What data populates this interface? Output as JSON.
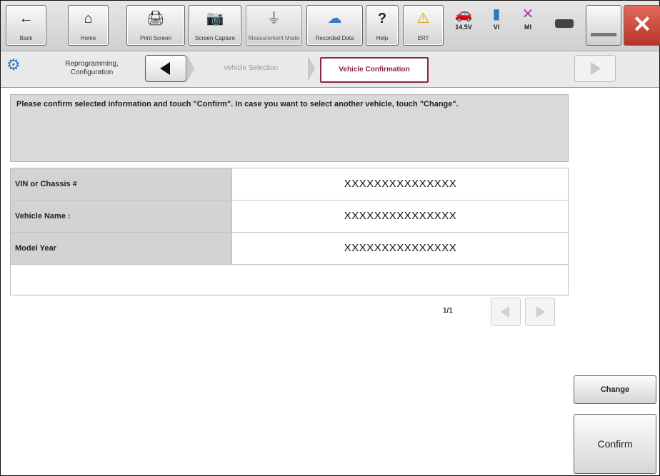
{
  "toolbar": {
    "buttons": [
      {
        "label": "Back",
        "icon": "←"
      },
      {
        "label": "Home",
        "icon": "⌂"
      },
      {
        "label": "Print Screen",
        "icon": "🖨"
      },
      {
        "label": "Screen Capture",
        "icon": "📷"
      },
      {
        "label": "Measurement Mode",
        "icon": "⏚"
      },
      {
        "label": "Recorded Data",
        "icon": "☁"
      },
      {
        "label": "Help",
        "icon": "?"
      },
      {
        "label": "ERT",
        "icon": "⚠"
      }
    ],
    "status": [
      {
        "label": "14.5V",
        "icon": "🚗"
      },
      {
        "label": "VI",
        "icon": "▮"
      },
      {
        "label": "MI",
        "icon": "✕"
      }
    ]
  },
  "breadcrumb": {
    "section": "Reprogramming, Configuration",
    "steps": [
      "Vehicle Selection",
      "Vehicle Confirmation"
    ]
  },
  "message": "Please confirm selected information and touch \"Confirm\". In case you want to select another vehicle, touch \"Change\".",
  "table": {
    "rows": [
      {
        "key": "VIN or Chassis #",
        "value": "XXXXXXXXXXXXXXX"
      },
      {
        "key": "Vehicle Name :",
        "value": "XXXXXXXXXXXXXXX"
      },
      {
        "key": "Model Year",
        "value": "XXXXXXXXXXXXXXX"
      }
    ]
  },
  "pager": {
    "text": "1/1"
  },
  "actions": {
    "change": "Change",
    "confirm": "Confirm"
  },
  "colors": {
    "accent": "#8a2444",
    "grey_bg": "#d9d9d9"
  }
}
